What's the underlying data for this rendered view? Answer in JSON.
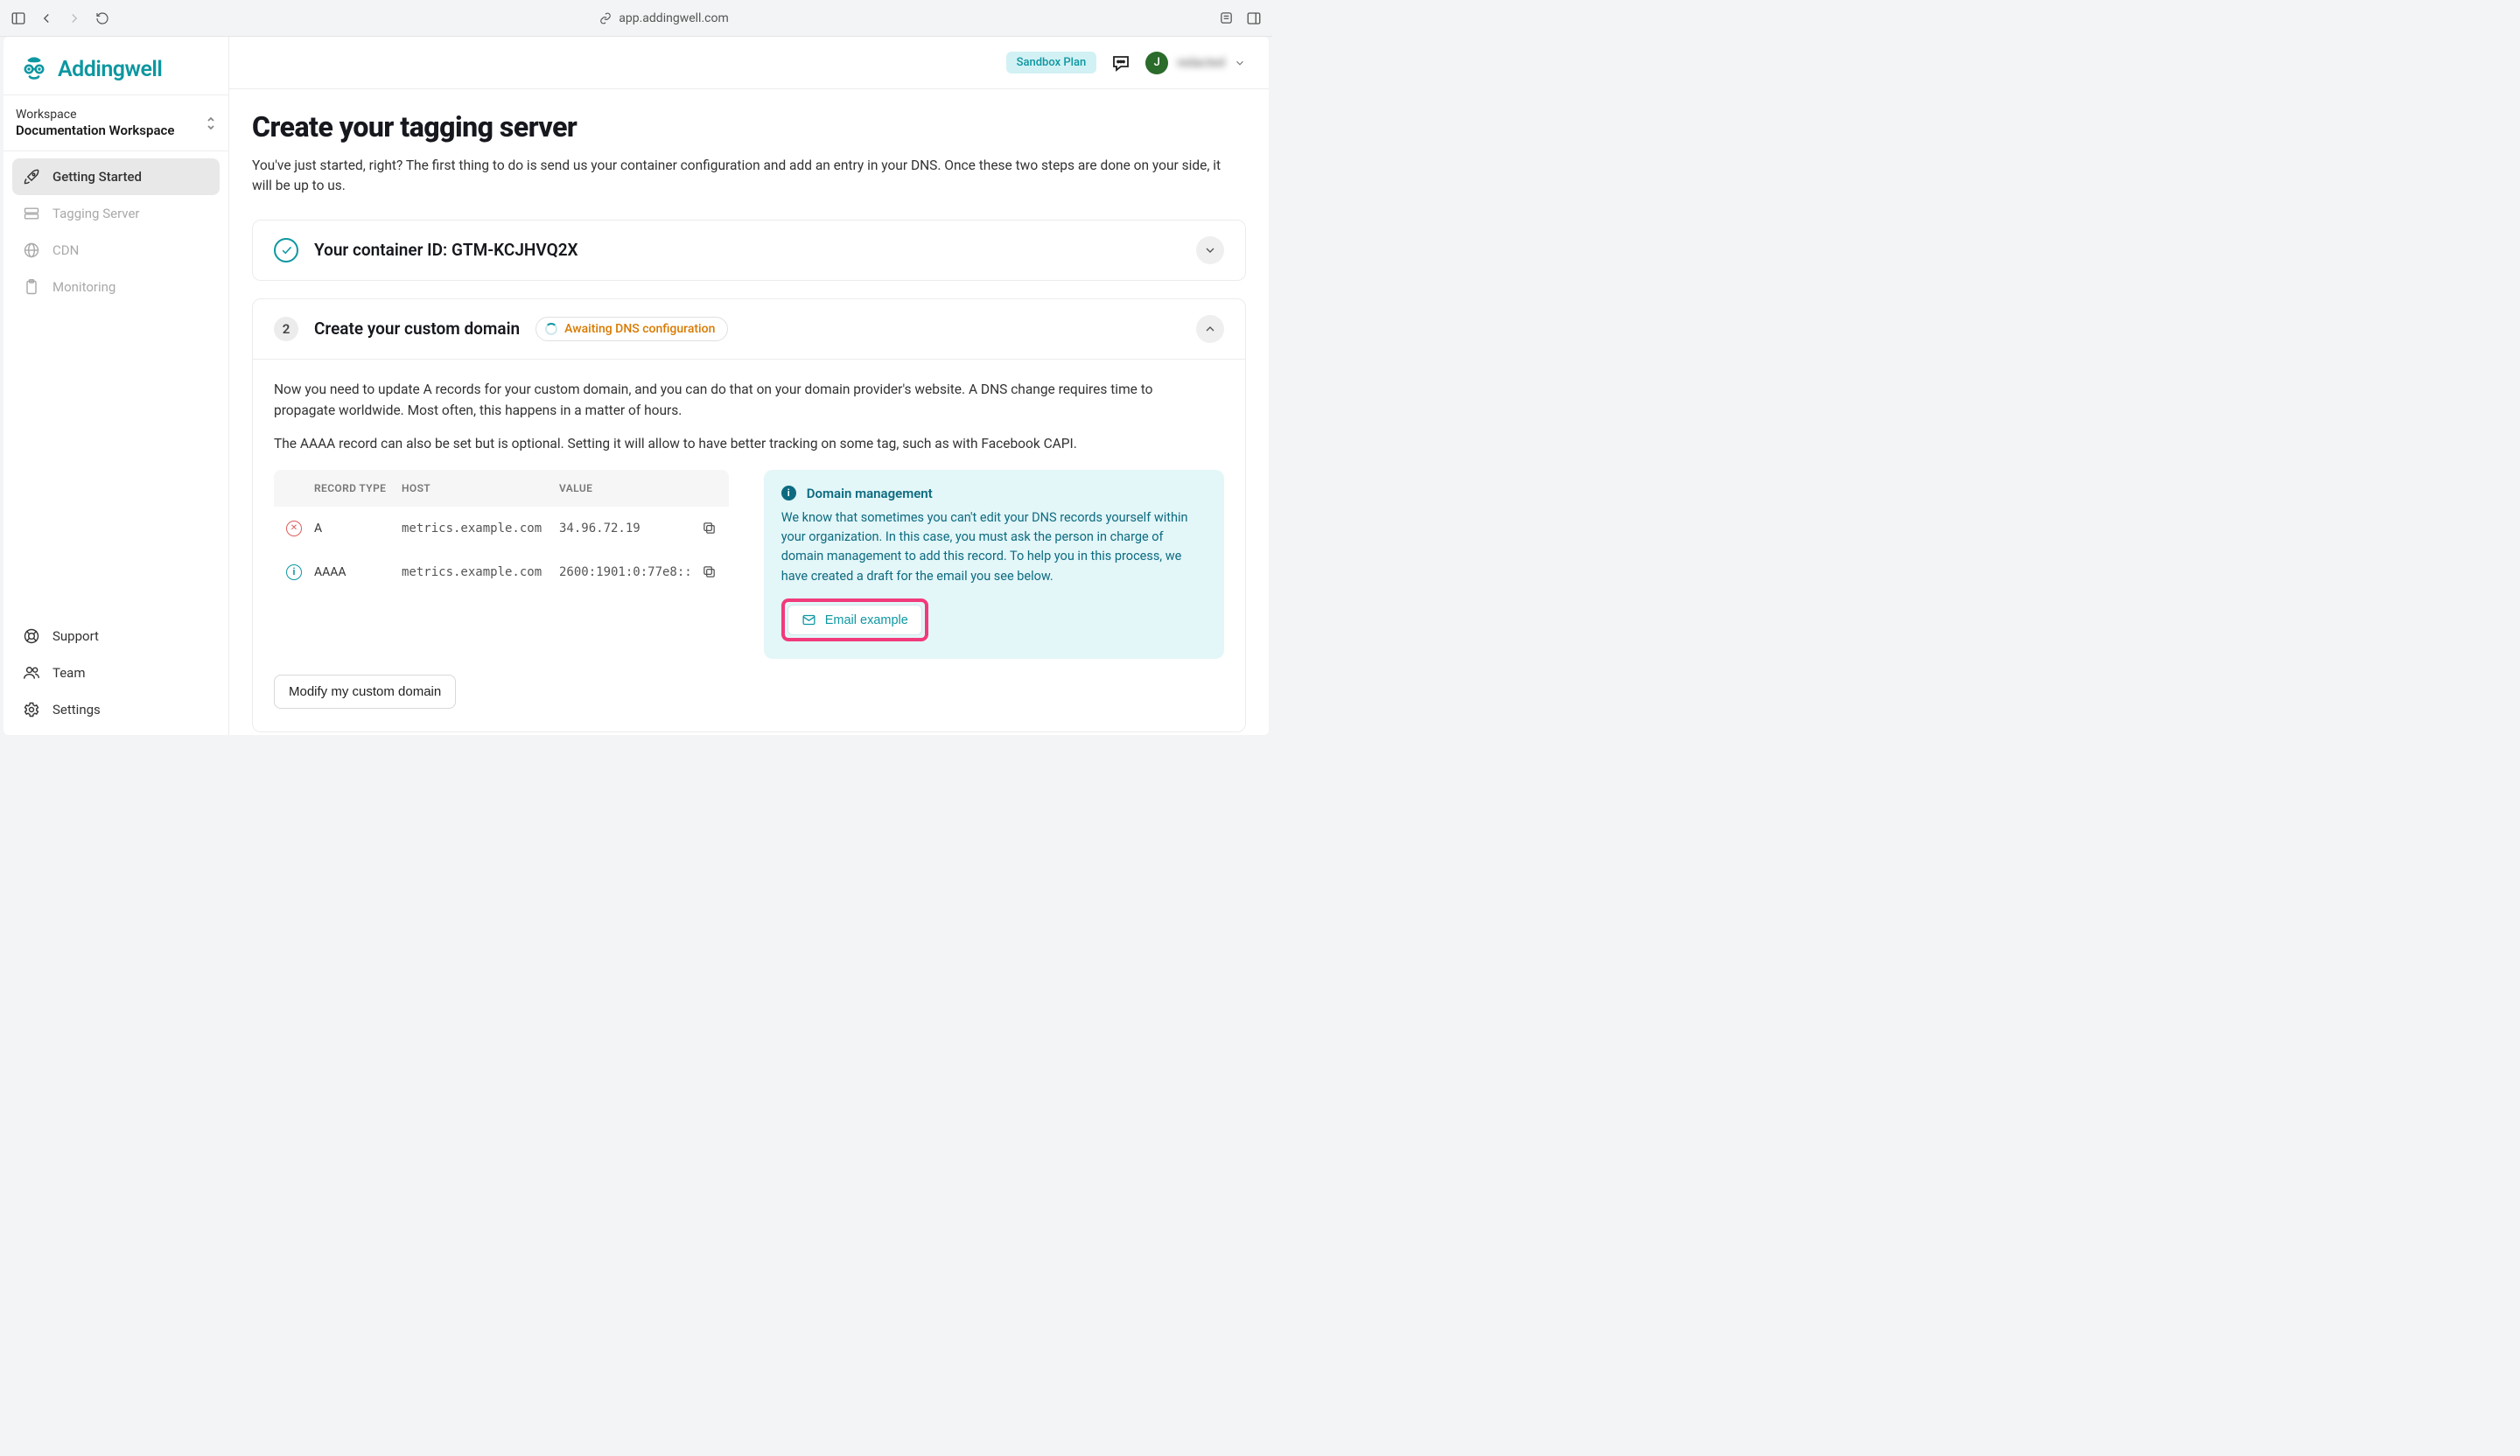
{
  "browser": {
    "url": "app.addingwell.com"
  },
  "brand": {
    "name": "Addingwell"
  },
  "workspace": {
    "label": "Workspace",
    "name": "Documentation Workspace"
  },
  "sidebar": {
    "items": [
      {
        "label": "Getting Started"
      },
      {
        "label": "Tagging Server"
      },
      {
        "label": "CDN"
      },
      {
        "label": "Monitoring"
      }
    ],
    "bottom": [
      {
        "label": "Support"
      },
      {
        "label": "Team"
      },
      {
        "label": "Settings"
      }
    ]
  },
  "topbar": {
    "plan": "Sandbox Plan",
    "user_initial": "J",
    "user_name": "redacted"
  },
  "page": {
    "title": "Create your tagging server",
    "subtitle": "You've just started, right? The first thing to do is send us your container configuration and add an entry in your DNS. Once these two steps are done on your side, it will be up to us."
  },
  "step1": {
    "title_prefix": "Your container ID: ",
    "container_id": "GTM-KCJHVQ2X"
  },
  "step2": {
    "number": "2",
    "title": "Create your custom domain",
    "status": "Awaiting DNS configuration",
    "body_p1": "Now you need to update A records for your custom domain, and you can do that on your domain provider's website. A DNS change requires time to propagate worldwide. Most often, this happens in a matter of hours.",
    "body_p2": "The AAAA record can also be set but is optional. Setting it will allow to have better tracking on some tag, such as with Facebook CAPI.",
    "table": {
      "headers": {
        "type": "RECORD TYPE",
        "host": "HOST",
        "value": "VALUE"
      },
      "rows": [
        {
          "status": "error",
          "type": "A",
          "host": "metrics.example.com",
          "value": "34.96.72.19"
        },
        {
          "status": "info",
          "type": "AAAA",
          "host": "metrics.example.com",
          "value": "2600:1901:0:77e8::"
        }
      ]
    },
    "info": {
      "title": "Domain management",
      "body": "We know that sometimes you can't edit your DNS records yourself within your organization. In this case, you must ask the person in charge of domain management to add this record. To help you in this process, we have created a draft for the email you see below.",
      "button": "Email example"
    },
    "modify_button": "Modify my custom domain"
  }
}
